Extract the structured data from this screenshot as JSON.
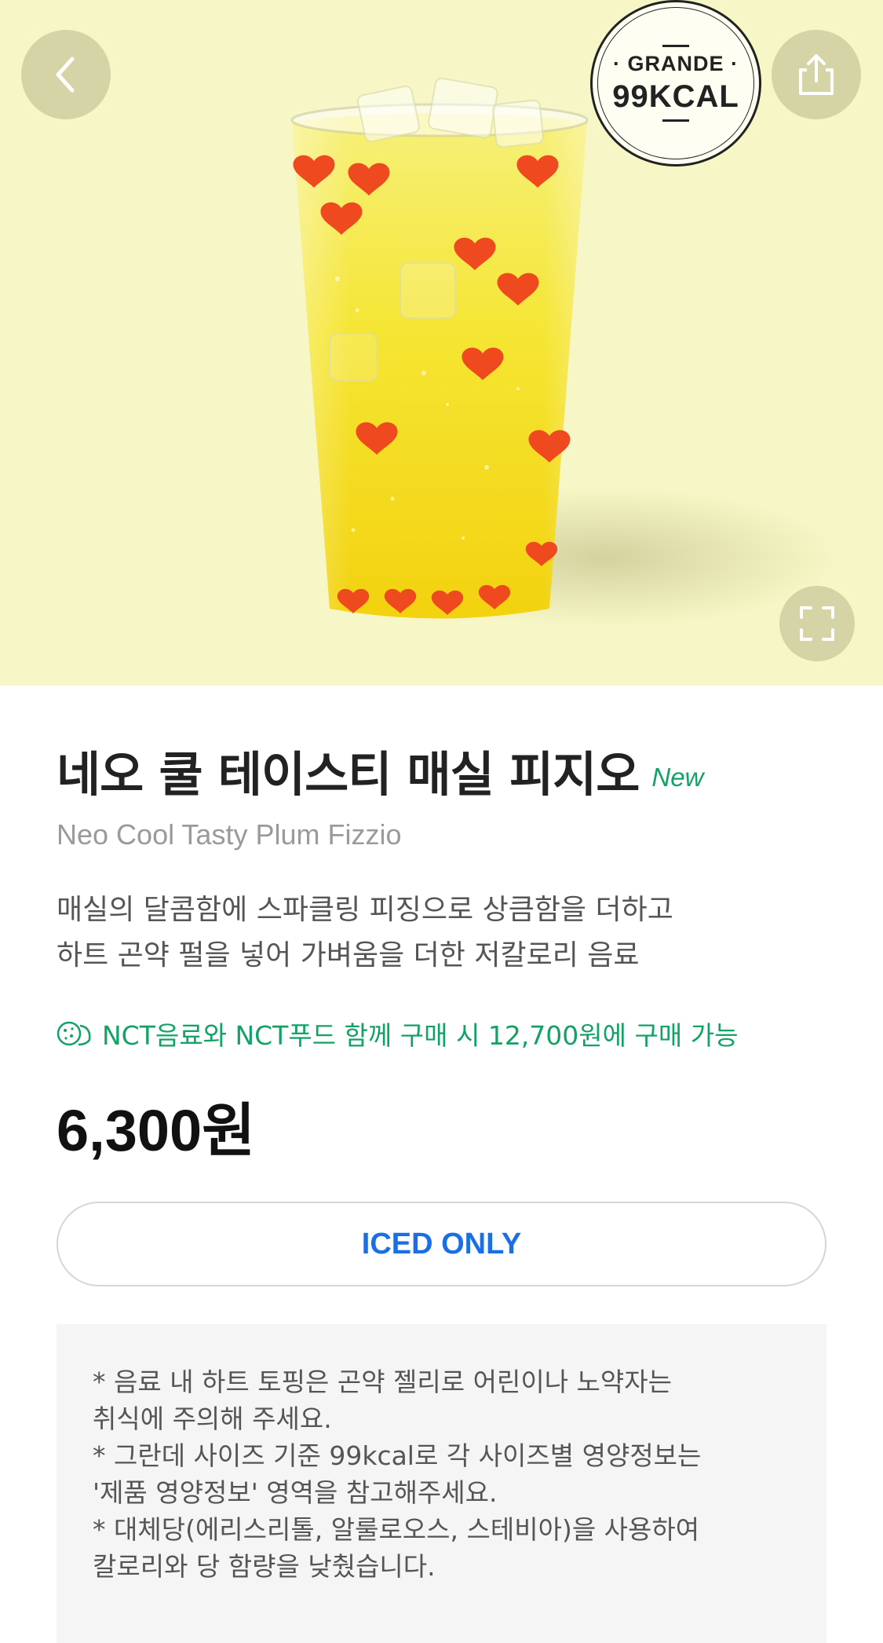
{
  "hero": {
    "background": "#f7f6c6",
    "kcal_badge": {
      "size": "· GRANDE ·",
      "calories": "99KCAL"
    }
  },
  "icons": {
    "back": "chevron-left-icon",
    "share": "share-icon",
    "fullscreen": "fullscreen-icon",
    "promo": "cookie-icon"
  },
  "product": {
    "name_ko": "네오 쿨 테이스티 매실 피지오",
    "badge": "New",
    "name_en": "Neo Cool Tasty Plum Fizzio",
    "description": [
      "매실의 달콤함에 스파클링 피징으로 상큼함을 더하고",
      "하트 곤약 펄을 넣어 가벼움을 더한 저칼로리 음료"
    ],
    "promo": "NCT음료와 NCT푸드 함께 구매 시 12,700원에 구매 가능",
    "price": "6,300원",
    "temperature_option": "ICED ONLY"
  },
  "notice": {
    "lines": [
      "* 음료 내 하트 토핑은 곤약 젤리로 어린이나 노약자는",
      "취식에 주의해 주세요.",
      "* 그란데 사이즈 기준 99kcal로 각 사이즈별 영양정보는",
      "'제품 영양정보' 영역을 참고해주세요.",
      "* 대체당(에리스리톨, 알룰로오스, 스테비아)을 사용하여",
      "칼로리와 당 함량을 낮췄습니다."
    ]
  },
  "colors": {
    "accent_green": "#12a266",
    "iced_blue": "#1b6fe6",
    "price": "#111111"
  }
}
